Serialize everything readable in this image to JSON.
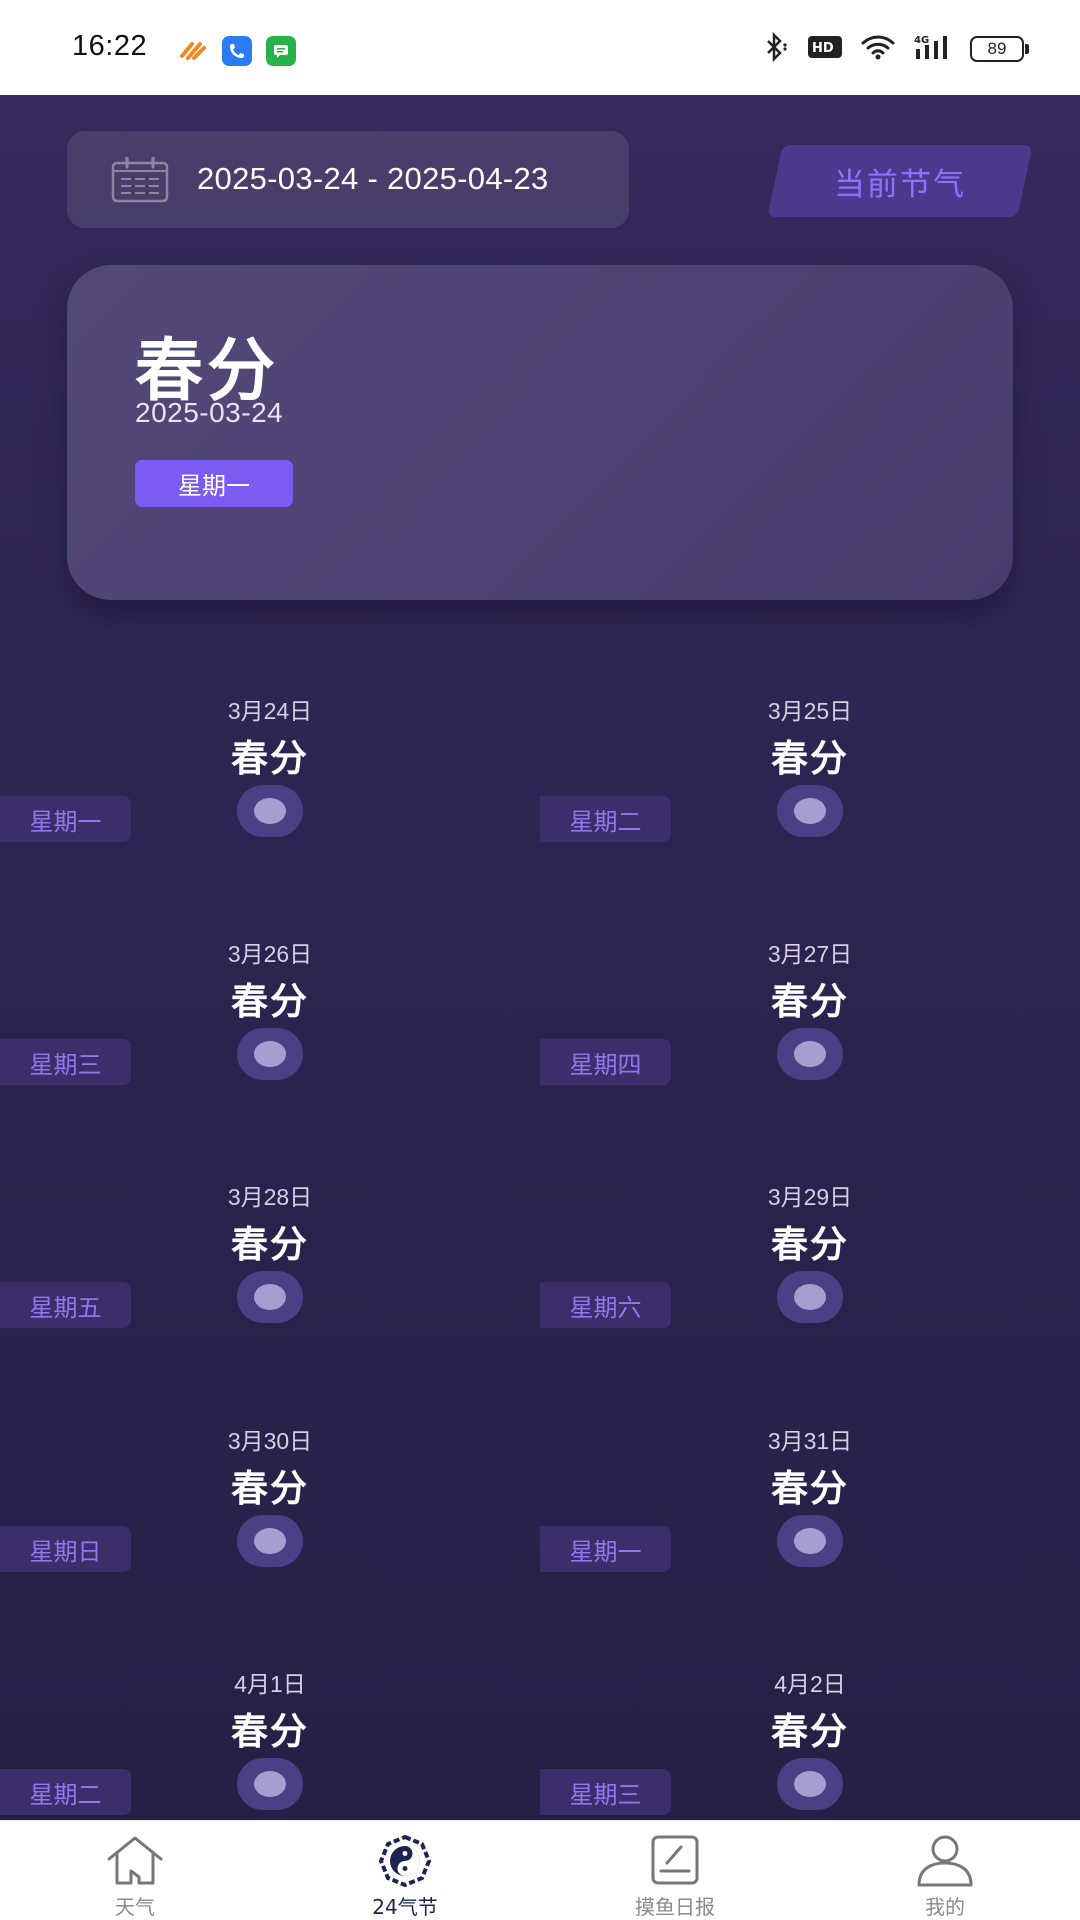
{
  "status_bar": {
    "time": "16:22",
    "notification_icons": [
      "tasks-app-icon",
      "phone-app-icon",
      "messages-app-icon"
    ],
    "system_icons": [
      "bluetooth-icon",
      "hd-icon",
      "wifi-icon",
      "signal-4g-icon"
    ],
    "battery": "89"
  },
  "header": {
    "date_range": "2025-03-24 - 2025-04-23",
    "current_term_button": "当前节气"
  },
  "hero": {
    "title": "春分",
    "date": "2025-03-24",
    "weekday": "星期一"
  },
  "days": [
    {
      "date": "3月24日",
      "term": "春分",
      "weekday": "星期一"
    },
    {
      "date": "3月25日",
      "term": "春分",
      "weekday": "星期二"
    },
    {
      "date": "3月26日",
      "term": "春分",
      "weekday": "星期三"
    },
    {
      "date": "3月27日",
      "term": "春分",
      "weekday": "星期四"
    },
    {
      "date": "3月28日",
      "term": "春分",
      "weekday": "星期五"
    },
    {
      "date": "3月29日",
      "term": "春分",
      "weekday": "星期六"
    },
    {
      "date": "3月30日",
      "term": "春分",
      "weekday": "星期日"
    },
    {
      "date": "3月31日",
      "term": "春分",
      "weekday": "星期一"
    },
    {
      "date": "4月1日",
      "term": "春分",
      "weekday": "星期二"
    },
    {
      "date": "4月2日",
      "term": "春分",
      "weekday": "星期三"
    }
  ],
  "bottom_nav": {
    "items": [
      {
        "label": "天气",
        "icon": "house-icon",
        "active": false
      },
      {
        "label": "24气节",
        "icon": "yin-yang-bagua-icon",
        "active": true
      },
      {
        "label": "摸鱼日报",
        "icon": "edit-note-icon",
        "active": false
      },
      {
        "label": "我的",
        "icon": "user-icon",
        "active": false
      }
    ]
  },
  "colors": {
    "accent": "#7b5cf3",
    "weekday_text": "#8d78ee",
    "background": "#2b2450",
    "nav_active": "#1b2450"
  }
}
